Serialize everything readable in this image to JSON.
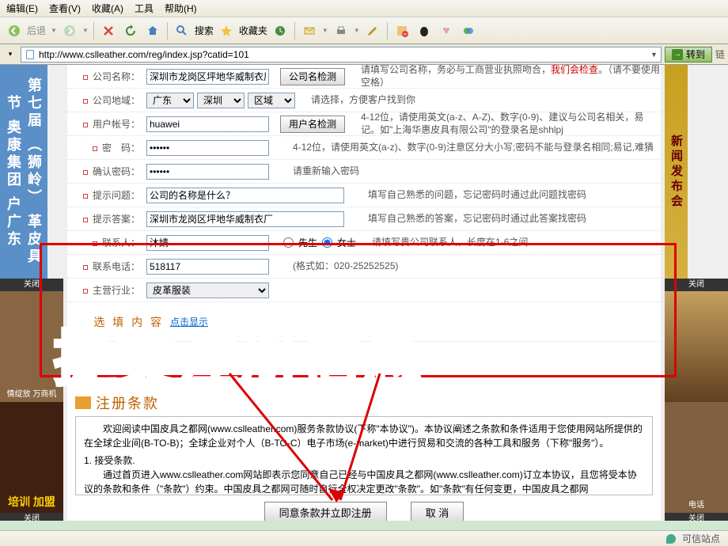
{
  "menu": {
    "items": [
      "编辑(E)",
      "查看(V)",
      "收藏(A)",
      "工具",
      "帮助(H)"
    ]
  },
  "toolbar": {
    "back": "后退",
    "search": "搜索",
    "fav": "收藏夹"
  },
  "addr": {
    "dropdown": "▾",
    "url": "http://www.cslleather.com/reg/index.jsp?catid=101",
    "go": "转到",
    "links": "链"
  },
  "ads": {
    "left": {
      "banner": "第七届\n（狮岭）\n革皮具节\n奥康集团\n户广东",
      "close": "关闭",
      "mid": "情绽放\n万商机",
      "bot": "培训\n加盟"
    },
    "right": {
      "banner": "新闻发布会",
      "close": "关闭",
      "phone": "电话"
    }
  },
  "form": {
    "rows": [
      {
        "label": "公司名称：",
        "value": "深圳市龙岗区坪地华威制衣厂",
        "btn": "公司名检测",
        "hint1": "请填写公司名称，务必与工商营业执照吻合，",
        "red": "我们会检查",
        "hint2": "。（请不要使用空格）"
      },
      {
        "label": "公司地域：",
        "sel1": "广东",
        "sel2": "深圳",
        "sel3": "区域",
        "hint": "请选择，方便客户找到你"
      },
      {
        "label": "用户帐号：",
        "value": "huawei",
        "btn": "用户名检测",
        "hint": "4-12位，请使用英文(a-z、A-Z)、数字(0-9)、建议与公司名相关，易记。如\"上海华惠皮具有限公司\"的登录名是shhlpj"
      },
      {
        "label": "密　码：",
        "value": "••••••",
        "hint": "4-12位，请使用英文(a-z)、数字(0-9)注意区分大小写;密码不能与登录名相同;易记,难猜"
      },
      {
        "label": "确认密码：",
        "value": "••••••",
        "hint": "请重新输入密码"
      },
      {
        "label": "提示问题：",
        "value": "公司的名称是什么？",
        "hint": "填写自己熟悉的问题，忘记密码时通过此问题找密码"
      },
      {
        "label": "提示答案：",
        "value": "深圳市龙岗区坪地华威制衣厂",
        "hint": "填写自己熟悉的答案，忘记密码时通过此答案找密码"
      },
      {
        "label": "联系人：",
        "value": "沐婧",
        "radio1": "先生",
        "radio2": "女士",
        "hint": "请填写贵公司联系人，长度在1-6之间"
      },
      {
        "label": "联系电话：",
        "value": "518117",
        "hint": "(格式如：020-25252525)"
      },
      {
        "label": "主营行业：",
        "sel": "皮革服装",
        "hint": ""
      },
      {
        "label": "选 填 内 容",
        "link": "点击显示"
      }
    ]
  },
  "terms": {
    "title": "注册条款",
    "body_l1": "　　欢迎阅读中国皮具之都网(www.cslleather.com)服务条款协议(下称\"本协议\")。本协议阐述之条款和条件适用于您使用网站所提供的在全球企业间(B-TO-B)；全球企业对个人（B-TO-C）电子市场(e-market)中进行贸易和交流的各种工具和服务（下称\"服务\"）。",
    "body_l2": "1. 接受条款.",
    "body_l3": "　　通过首页进入www.cslleather.com网站即表示您同意自己已经与中国皮具之都网(www.cslleather.com)订立本协议，且您将受本协议的条款和条件（\"条款\"）约束。中国皮具之都网可随时自行全权决定更改\"条款\"。如\"条款\"有任何变更，中国皮具之都网"
  },
  "buttons": {
    "agree": "同意条款并立即注册",
    "cancel": "取 消"
  },
  "status": {
    "trusted": "可信站点"
  },
  "overlay": {
    "text": "提交注册信息"
  }
}
